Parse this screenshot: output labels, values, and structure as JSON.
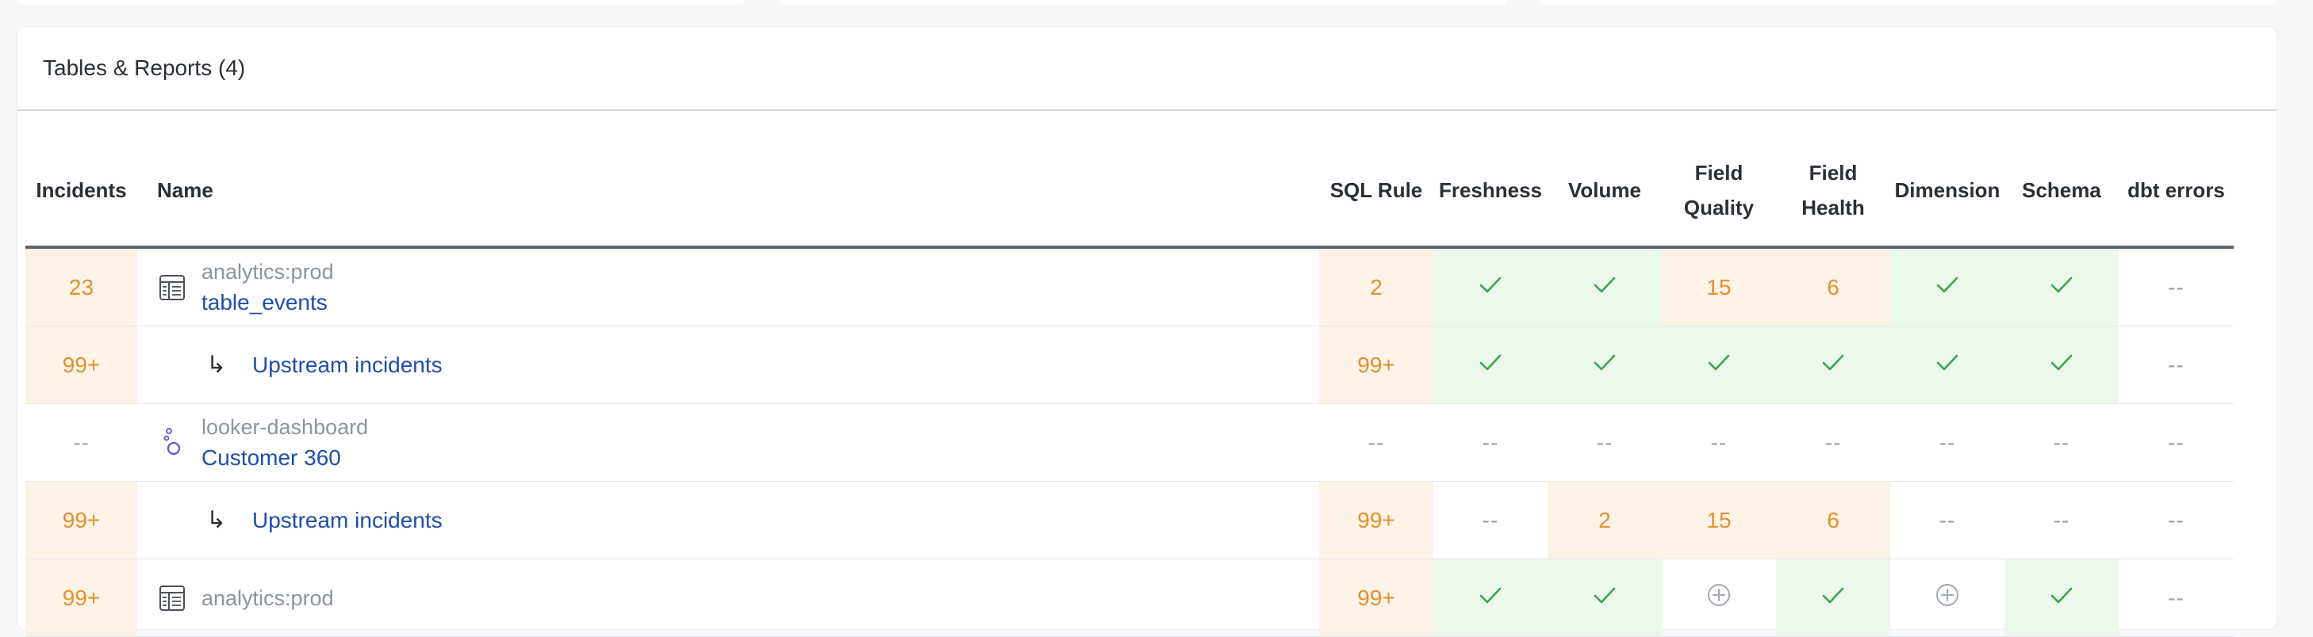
{
  "section": {
    "title": "Tables & Reports (4)"
  },
  "columns": [
    "Incidents",
    "Name",
    "SQL Rule",
    "Freshness",
    "Volume",
    "Field Quality",
    "Field Health",
    "Dimension",
    "Schema",
    "dbt errors"
  ],
  "colors": {
    "orange_bg": "#fdf2e6",
    "green_bg": "#ecf8ec",
    "orange_text": "#e4902e",
    "link": "#1f4fa8",
    "check": "#3aa64a"
  },
  "rows": [
    {
      "incidents": "23",
      "type": "table",
      "icon": "table-icon",
      "sub": "analytics:prod",
      "name": "table_events",
      "cells": [
        {
          "kind": "num",
          "text": "2",
          "bg": "orange"
        },
        {
          "kind": "check",
          "bg": "green"
        },
        {
          "kind": "check",
          "bg": "green"
        },
        {
          "kind": "num",
          "text": "15",
          "bg": "orange"
        },
        {
          "kind": "num",
          "text": "6",
          "bg": "orange"
        },
        {
          "kind": "check",
          "bg": "green"
        },
        {
          "kind": "check",
          "bg": "green"
        },
        {
          "kind": "dash",
          "text": "--",
          "bg": "none"
        }
      ]
    },
    {
      "incidents": "99+",
      "type": "upstream",
      "icon": "return-arrow-icon",
      "name": "Upstream incidents",
      "cells": [
        {
          "kind": "num",
          "text": "99+",
          "bg": "orange"
        },
        {
          "kind": "check",
          "bg": "green"
        },
        {
          "kind": "check",
          "bg": "green"
        },
        {
          "kind": "check",
          "bg": "green"
        },
        {
          "kind": "check",
          "bg": "green"
        },
        {
          "kind": "check",
          "bg": "green"
        },
        {
          "kind": "check",
          "bg": "green"
        },
        {
          "kind": "dash",
          "text": "--",
          "bg": "none"
        }
      ]
    },
    {
      "incidents": "--",
      "type": "report",
      "icon": "looker-icon",
      "sub": "looker-dashboard",
      "name": "Customer 360",
      "cells": [
        {
          "kind": "dash",
          "text": "--",
          "bg": "none"
        },
        {
          "kind": "dash",
          "text": "--",
          "bg": "none"
        },
        {
          "kind": "dash",
          "text": "--",
          "bg": "none"
        },
        {
          "kind": "dash",
          "text": "--",
          "bg": "none"
        },
        {
          "kind": "dash",
          "text": "--",
          "bg": "none"
        },
        {
          "kind": "dash",
          "text": "--",
          "bg": "none"
        },
        {
          "kind": "dash",
          "text": "--",
          "bg": "none"
        },
        {
          "kind": "dash",
          "text": "--",
          "bg": "none"
        }
      ]
    },
    {
      "incidents": "99+",
      "type": "upstream",
      "icon": "return-arrow-icon",
      "name": "Upstream incidents",
      "cells": [
        {
          "kind": "num",
          "text": "99+",
          "bg": "orange"
        },
        {
          "kind": "dash",
          "text": "--",
          "bg": "none"
        },
        {
          "kind": "num",
          "text": "2",
          "bg": "orange"
        },
        {
          "kind": "num",
          "text": "15",
          "bg": "orange"
        },
        {
          "kind": "num",
          "text": "6",
          "bg": "orange"
        },
        {
          "kind": "dash",
          "text": "--",
          "bg": "none"
        },
        {
          "kind": "dash",
          "text": "--",
          "bg": "none"
        },
        {
          "kind": "dash",
          "text": "--",
          "bg": "none"
        }
      ]
    },
    {
      "incidents": "99+",
      "type": "table",
      "icon": "table-icon",
      "sub": "analytics:prod",
      "name": "",
      "cells": [
        {
          "kind": "num",
          "text": "99+",
          "bg": "orange"
        },
        {
          "kind": "check",
          "bg": "green"
        },
        {
          "kind": "check",
          "bg": "green"
        },
        {
          "kind": "plus",
          "bg": "none"
        },
        {
          "kind": "check",
          "bg": "green"
        },
        {
          "kind": "plus",
          "bg": "none"
        },
        {
          "kind": "check",
          "bg": "green"
        },
        {
          "kind": "dash",
          "text": "--",
          "bg": "none"
        }
      ]
    }
  ]
}
